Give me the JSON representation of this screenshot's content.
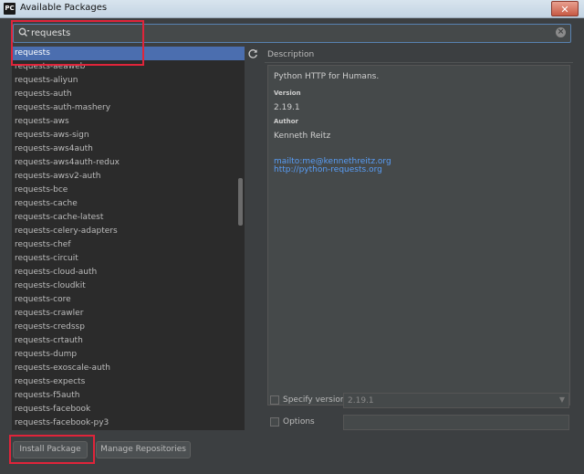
{
  "window": {
    "app_icon": "PC",
    "title": "Available Packages",
    "close_icon": "close-icon"
  },
  "search": {
    "value": "requests",
    "icon": "search-icon",
    "clear_icon": "clear-icon"
  },
  "packages": [
    "requests",
    "requests-aeaweb",
    "requests-aliyun",
    "requests-auth",
    "requests-auth-mashery",
    "requests-aws",
    "requests-aws-sign",
    "requests-aws4auth",
    "requests-aws4auth-redux",
    "requests-awsv2-auth",
    "requests-bce",
    "requests-cache",
    "requests-cache-latest",
    "requests-celery-adapters",
    "requests-chef",
    "requests-circuit",
    "requests-cloud-auth",
    "requests-cloudkit",
    "requests-core",
    "requests-crawler",
    "requests-credssp",
    "requests-crtauth",
    "requests-dump",
    "requests-exoscale-auth",
    "requests-expects",
    "requests-f5auth",
    "requests-facebook",
    "requests-facebook-py3"
  ],
  "selected_package": "requests",
  "description": {
    "title": "Description",
    "summary": "Python HTTP for Humans.",
    "version_label": "Version",
    "version": "2.19.1",
    "author_label": "Author",
    "author": "Kenneth Reitz",
    "link_mail": "mailto:me@kennethreitz.org",
    "link_web": "http://python-requests.org"
  },
  "options": {
    "specify_version_label": "Specify version",
    "specify_version_value": "2.19.1",
    "options_label": "Options",
    "options_value": ""
  },
  "buttons": {
    "install": "Install Package",
    "manage": "Manage Repositories"
  },
  "colors": {
    "background": "#3c3f41",
    "list_background": "#2b2b2b",
    "selection": "#4b6eaf",
    "link": "#589df6",
    "annotation_red": "#e0243a"
  }
}
